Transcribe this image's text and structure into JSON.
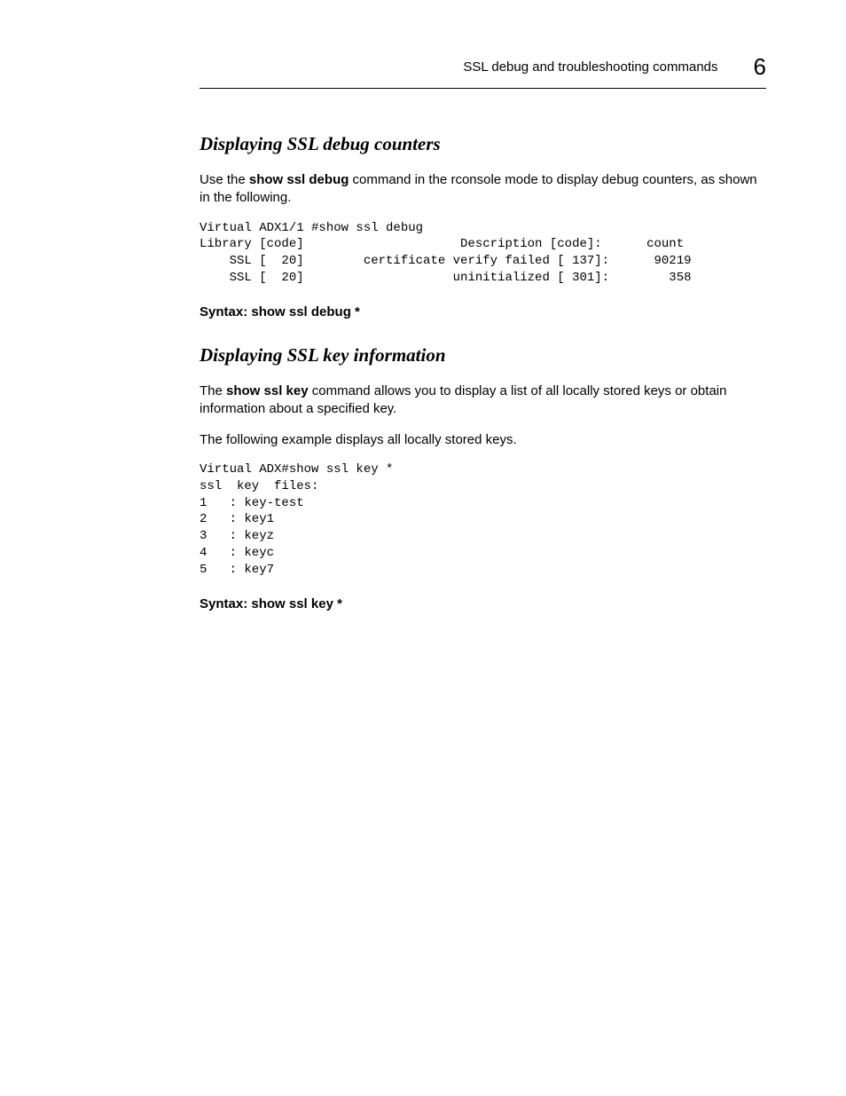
{
  "header": {
    "title": "SSL debug and troubleshooting commands",
    "chapter": "6"
  },
  "section1": {
    "heading": "Displaying SSL debug counters",
    "intro_pre": "Use the ",
    "intro_bold": "show ssl debug",
    "intro_post": " command in the rconsole mode to display debug counters, as shown in the following.",
    "code": "Virtual ADX1/1 #show ssl debug\nLibrary [code]                     Description [code]:      count\n    SSL [  20]        certificate verify failed [ 137]:      90219\n    SSL [  20]                    uninitialized [ 301]:        358",
    "syntax_label": "Syntax:  ",
    "syntax_cmd": "show ssl debug *"
  },
  "section2": {
    "heading": "Displaying SSL key information",
    "intro_pre": "The ",
    "intro_bold": "show ssl key",
    "intro_post": " command allows you to display a list of all locally stored keys or obtain information about a specified key.",
    "intro2": "The following example displays all locally stored keys.",
    "code": "Virtual ADX#show ssl key *\nssl  key  files:\n1   : key-test\n2   : key1\n3   : keyz\n4   : keyc\n5   : key7",
    "syntax_label": "Syntax:  ",
    "syntax_cmd": "show ssl key *"
  }
}
